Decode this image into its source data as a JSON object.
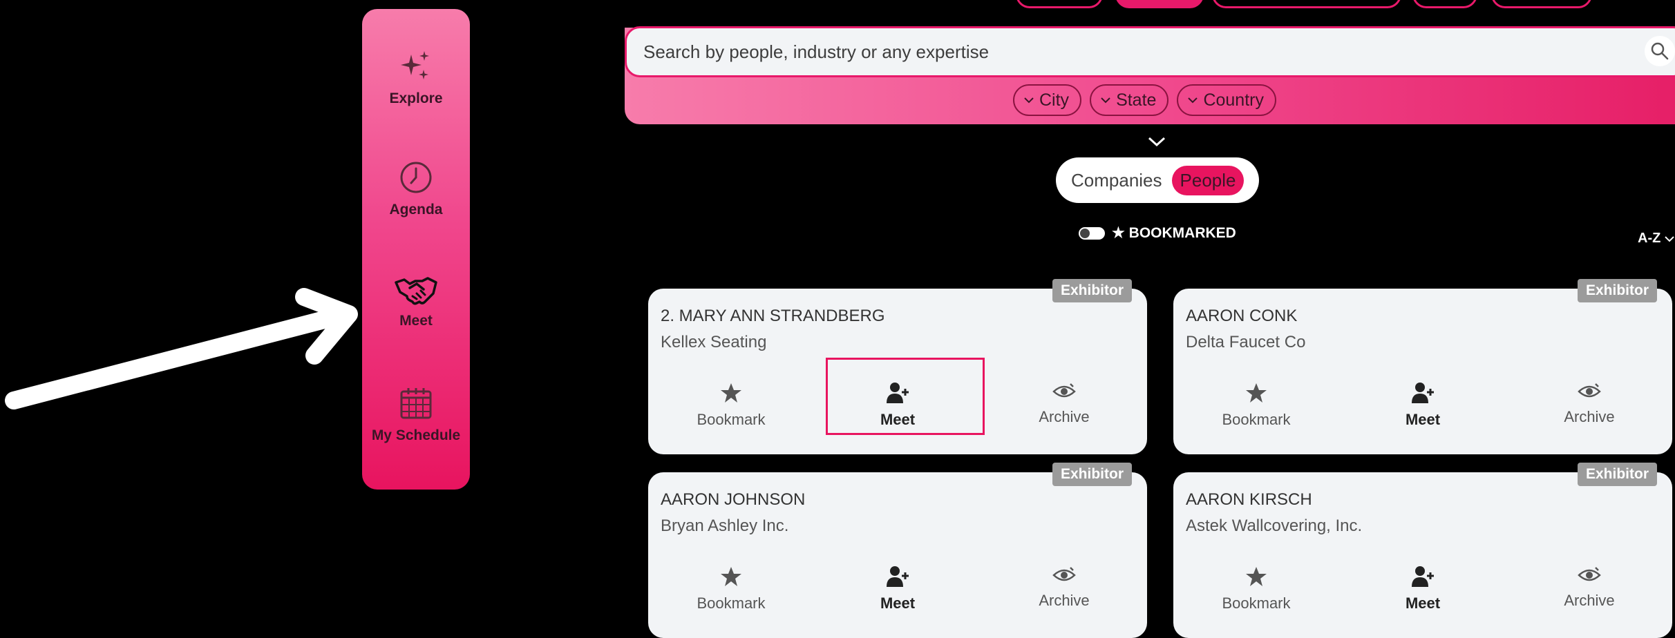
{
  "sidebar": {
    "items": [
      {
        "label": "Explore",
        "icon": "sparkles-icon"
      },
      {
        "label": "Agenda",
        "icon": "clock-icon"
      },
      {
        "label": "Meet",
        "icon": "handshake-icon"
      },
      {
        "label": "My Schedule",
        "icon": "calendar-icon"
      }
    ]
  },
  "search": {
    "placeholder": "Search by people, industry or any expertise",
    "filters": [
      "City",
      "State",
      "Country"
    ]
  },
  "toggle": {
    "companies": "Companies",
    "people": "People",
    "active": "People"
  },
  "bookmark_filter": {
    "label": "★ BOOKMARKED"
  },
  "sort": {
    "label": "A-Z"
  },
  "cards": [
    {
      "name": "2. MARY ANN STRANDBERG",
      "company": "Kellex Seating",
      "badge": "Exhibitor"
    },
    {
      "name": "AARON CONK",
      "company": "Delta Faucet Co",
      "badge": "Exhibitor"
    },
    {
      "name": "AARON JOHNSON",
      "company": "Bryan Ashley Inc.",
      "badge": "Exhibitor"
    },
    {
      "name": "AARON KIRSCH",
      "company": "Astek Wallcovering, Inc.",
      "badge": "Exhibitor"
    }
  ],
  "actions": {
    "bookmark": "Bookmark",
    "meet": "Meet",
    "archive": "Archive"
  },
  "colors": {
    "accent": "#e8145f",
    "sidebar_top": "#f77cab",
    "card_bg": "#f2f4f6",
    "badge_bg": "#9b9b9b"
  }
}
